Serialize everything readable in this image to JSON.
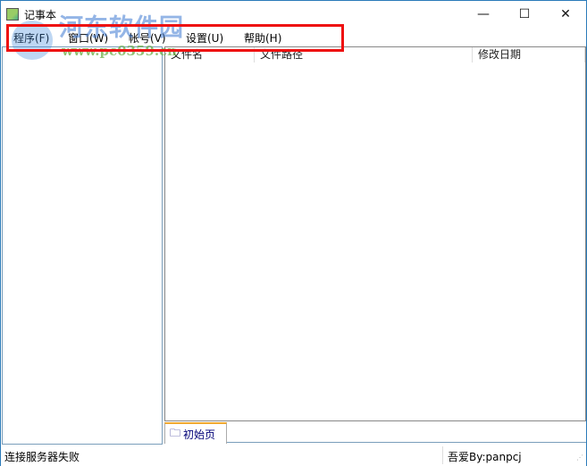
{
  "window": {
    "title": "记事本",
    "minimize": "—",
    "maximize": "☐",
    "close": "✕"
  },
  "menu": [
    "程序(F)",
    "窗口(W)",
    "帐号(V)",
    "设置(U)",
    "帮助(H)"
  ],
  "table": {
    "columns": [
      "文件名",
      "文件路径",
      "修改日期"
    ]
  },
  "tabs": [
    {
      "label": "初始页",
      "icon": "folder-icon"
    }
  ],
  "status": {
    "left": "连接服务器失败",
    "right": "吾爱By:panpcj"
  },
  "watermark": {
    "name": "河东软件园",
    "url": "www.pc0359.cn"
  },
  "colors": {
    "highlight": "#ee1111",
    "tab_accent": "#f0a830"
  }
}
